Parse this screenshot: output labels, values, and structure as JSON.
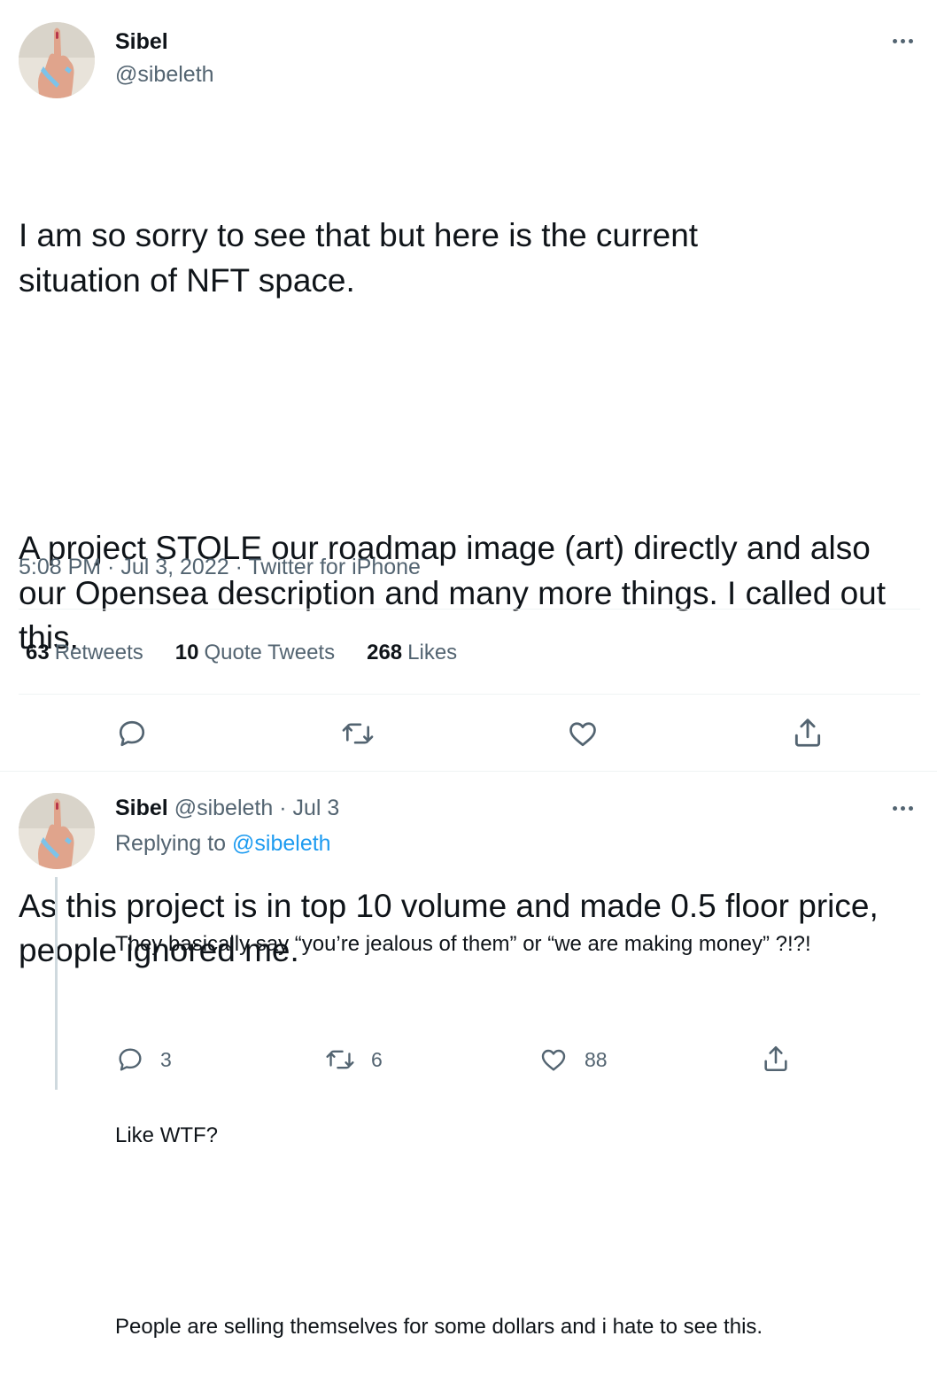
{
  "main_tweet": {
    "author_name": "Sibel",
    "author_handle": "@sibeleth",
    "text_p1": "I am so sorry to see that but here is the current situation of NFT space.",
    "text_p2": "A project STOLE our roadmap image (art) directly and also our Opensea description and many more things. I called out this.",
    "text_p3": "As this project is in top 10 volume and made 0.5 floor price, people ignored me.",
    "meta": "5:08 PM · Jul 3, 2022 · Twitter for iPhone",
    "stats": {
      "retweets_count": "63",
      "retweets_label": "Retweets",
      "quotes_count": "10",
      "quotes_label": "Quote Tweets",
      "likes_count": "268",
      "likes_label": "Likes"
    }
  },
  "reply_tweet": {
    "author_name": "Sibel",
    "author_handle": "@sibeleth",
    "date": "· Jul 3",
    "replying_prefix": "Replying to",
    "replying_handle": "@sibeleth",
    "text_l1": "They basically say “you’re jealous of them” or “we are making money” ?!?!",
    "text_l2": "Like WTF?",
    "text_l3": "People are selling themselves for some dollars and i hate to see this.",
    "reply_count": "3",
    "retweet_count": "6",
    "like_count": "88"
  },
  "colors": {
    "text": "#0f1419",
    "secondary": "#536471",
    "link": "#1d9bf0",
    "divider": "#eff3f4",
    "nail": "#7cc3ea"
  },
  "icons": [
    "more-icon",
    "reply-icon",
    "retweet-icon",
    "like-icon",
    "share-icon"
  ]
}
